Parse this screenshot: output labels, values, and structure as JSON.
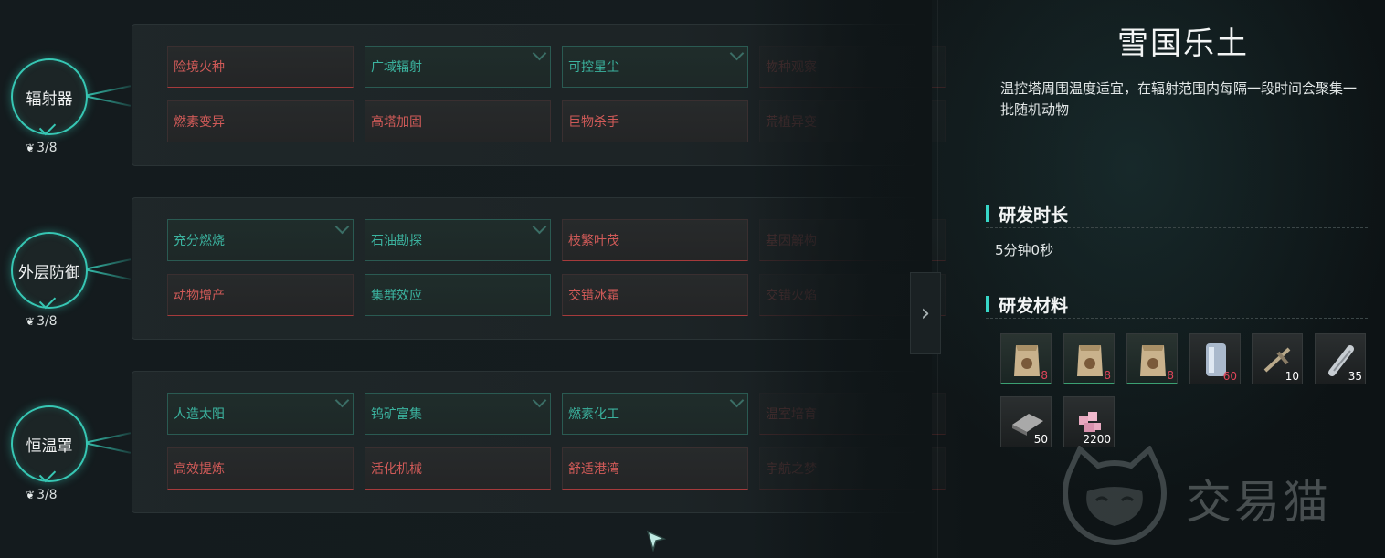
{
  "branches": [
    {
      "name": "辐射器",
      "count": "3/8",
      "tiles": [
        [
          "险境火种",
          "red"
        ],
        [
          "广域辐射",
          "green"
        ],
        [
          "可控星尘",
          "green"
        ],
        [
          "物种观察",
          "red"
        ],
        [
          "燃素变异",
          "red"
        ],
        [
          "高塔加固",
          "red"
        ],
        [
          "巨物杀手",
          "red"
        ],
        [
          "荒植异变",
          "red"
        ]
      ]
    },
    {
      "name": "外层防御",
      "count": "3/8",
      "tiles": [
        [
          "充分燃烧",
          "green"
        ],
        [
          "石油勘探",
          "green"
        ],
        [
          "枝繁叶茂",
          "red"
        ],
        [
          "基因解构",
          "red"
        ],
        [
          "动物增产",
          "red"
        ],
        [
          "集群效应",
          "green"
        ],
        [
          "交错冰霜",
          "red"
        ],
        [
          "交错火焰",
          "red"
        ]
      ]
    },
    {
      "name": "恒温罩",
      "count": "3/8",
      "tiles": [
        [
          "人造太阳",
          "green"
        ],
        [
          "钨矿富集",
          "green"
        ],
        [
          "燃素化工",
          "green"
        ],
        [
          "温室培育",
          "red"
        ],
        [
          "高效提炼",
          "red"
        ],
        [
          "活化机械",
          "red"
        ],
        [
          "舒适港湾",
          "red"
        ],
        [
          "宇航之梦",
          "red"
        ]
      ]
    }
  ],
  "detail": {
    "title": "雪国乐土",
    "description": "温控塔周围温度适宜，在辐射范围内每隔一段时间会聚集一批随机动物",
    "duration_heading": "研发时长",
    "duration": "5分钟0秒",
    "materials_heading": "研发材料",
    "materials": [
      {
        "icon": "seed-bag-icon",
        "qty": "8",
        "qty_color": "red",
        "frame": "green"
      },
      {
        "icon": "seed-bag-icon",
        "qty": "8",
        "qty_color": "red",
        "frame": "green"
      },
      {
        "icon": "seed-bag-icon",
        "qty": "8",
        "qty_color": "red",
        "frame": "green"
      },
      {
        "icon": "metal-canister-icon",
        "qty": "60",
        "qty_color": "red",
        "frame": "gray"
      },
      {
        "icon": "crossbow-part-icon",
        "qty": "10",
        "qty_color": "white",
        "frame": "gray"
      },
      {
        "icon": "steel-pipe-icon",
        "qty": "35",
        "qty_color": "white",
        "frame": "gray"
      },
      {
        "icon": "metal-plate-icon",
        "qty": "50",
        "qty_color": "white",
        "frame": "gray"
      },
      {
        "icon": "pink-crystal-icon",
        "qty": "2200",
        "qty_color": "white",
        "frame": "gray"
      }
    ]
  },
  "watermark": {
    "text": "交易猫",
    "icon": "cat-logo-icon"
  },
  "colors": {
    "accent": "#37c7b4",
    "locked": "#d05a58",
    "unlocked": "#3bb39f"
  }
}
